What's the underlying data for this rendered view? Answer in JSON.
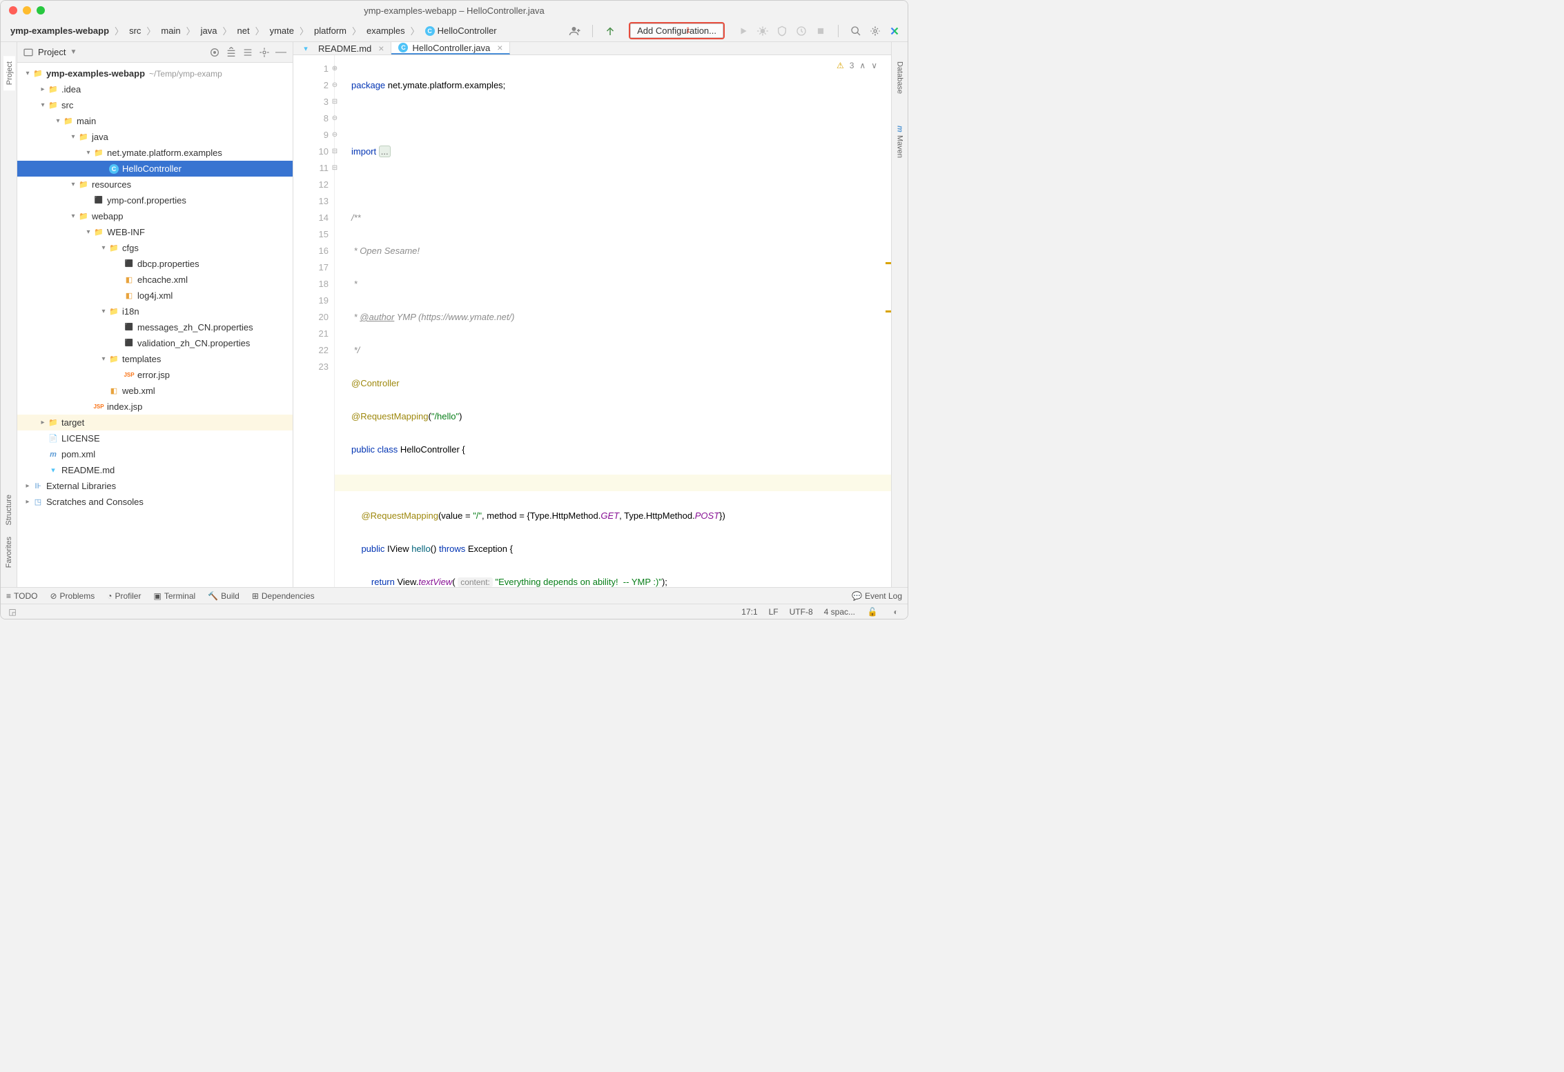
{
  "window": {
    "title": "ymp-examples-webapp – HelloController.java"
  },
  "breadcrumb": [
    "ymp-examples-webapp",
    "src",
    "main",
    "java",
    "net",
    "ymate",
    "platform",
    "examples",
    "HelloController"
  ],
  "run_config": {
    "label": "Add Configuration...",
    "annotation": "1"
  },
  "project_header": {
    "label": "Project"
  },
  "tree": {
    "root": {
      "name": "ymp-examples-webapp",
      "hint": "~/Temp/ymp-examp"
    },
    "idea": ".idea",
    "src": "src",
    "main": "main",
    "java": "java",
    "pkg": "net.ymate.platform.examples",
    "hello": "HelloController",
    "resources": "resources",
    "ymp_conf": "ymp-conf.properties",
    "webapp": "webapp",
    "webinf": "WEB-INF",
    "cfgs": "cfgs",
    "dbcp": "dbcp.properties",
    "ehcache": "ehcache.xml",
    "log4j": "log4j.xml",
    "i18n": "i18n",
    "msg_zh": "messages_zh_CN.properties",
    "val_zh": "validation_zh_CN.properties",
    "templates": "templates",
    "error_jsp": "error.jsp",
    "web_xml": "web.xml",
    "index_jsp": "index.jsp",
    "target": "target",
    "license": "LICENSE",
    "pom": "pom.xml",
    "readme": "README.md",
    "ext_libs": "External Libraries",
    "scratch": "Scratches and Consoles"
  },
  "tabs": [
    {
      "label": "README.md",
      "icon": "md",
      "active": false
    },
    {
      "label": "HelloController.java",
      "icon": "class",
      "active": true
    }
  ],
  "code": {
    "line_numbers": [
      1,
      2,
      3,
      8,
      9,
      10,
      11,
      12,
      13,
      14,
      15,
      16,
      17,
      18,
      19,
      20,
      21,
      22,
      23
    ],
    "package_kw": "package ",
    "package_name": "net.ymate.platform.examples;",
    "import_kw": "import ",
    "import_folded": "...",
    "doc_open": "/**",
    "doc_l1": " * Open Sesame!",
    "doc_l2": " *",
    "doc_l3_tag": "@author",
    "doc_l3_rest": " YMP (https://www.ymate.net/)",
    "doc_close": " */",
    "anno1": "@Controller",
    "anno2": "@RequestMapping",
    "anno2_arg": "(\"/hello\")",
    "cls_decl_kw": "public class ",
    "cls_name": "HelloController",
    "brace_open": " {",
    "anno3": "@RequestMapping",
    "anno3_open": "(",
    "anno3_p1": "value = ",
    "anno3_v1": "\"/\"",
    "anno3_sep": ", method = {Type.HttpMethod.",
    "anno3_get": "GET",
    "anno3_mid": ", Type.HttpMethod.",
    "anno3_post": "POST",
    "anno3_close": "})",
    "meth_kw": "public ",
    "meth_ret": "IView",
    "meth_name": " hello",
    "meth_params": "() ",
    "throws_kw": "throws ",
    "exc": "Exception",
    "mbrace": " {",
    "return_kw": "return ",
    "view": "View.",
    "textview": "textView",
    "tv_open": "( ",
    "hint": "content:",
    "tv_str": " \"Everything depends on ability!  -- YMP :)\"",
    "tv_close": ");",
    "mbrace_close": "}",
    "cls_brace_close": "}"
  },
  "inspection": {
    "warn_count": "3"
  },
  "left_rail": {
    "project": "Project",
    "structure": "Structure",
    "favorites": "Favorites"
  },
  "right_rail": {
    "database": "Database",
    "maven": "Maven"
  },
  "bottom_tabs": {
    "todo": "TODO",
    "problems": "Problems",
    "profiler": "Profiler",
    "terminal": "Terminal",
    "build": "Build",
    "deps": "Dependencies",
    "eventlog": "Event Log"
  },
  "status": {
    "pos": "17:1",
    "lf": "LF",
    "enc": "UTF-8",
    "indent": "4 spac..."
  }
}
